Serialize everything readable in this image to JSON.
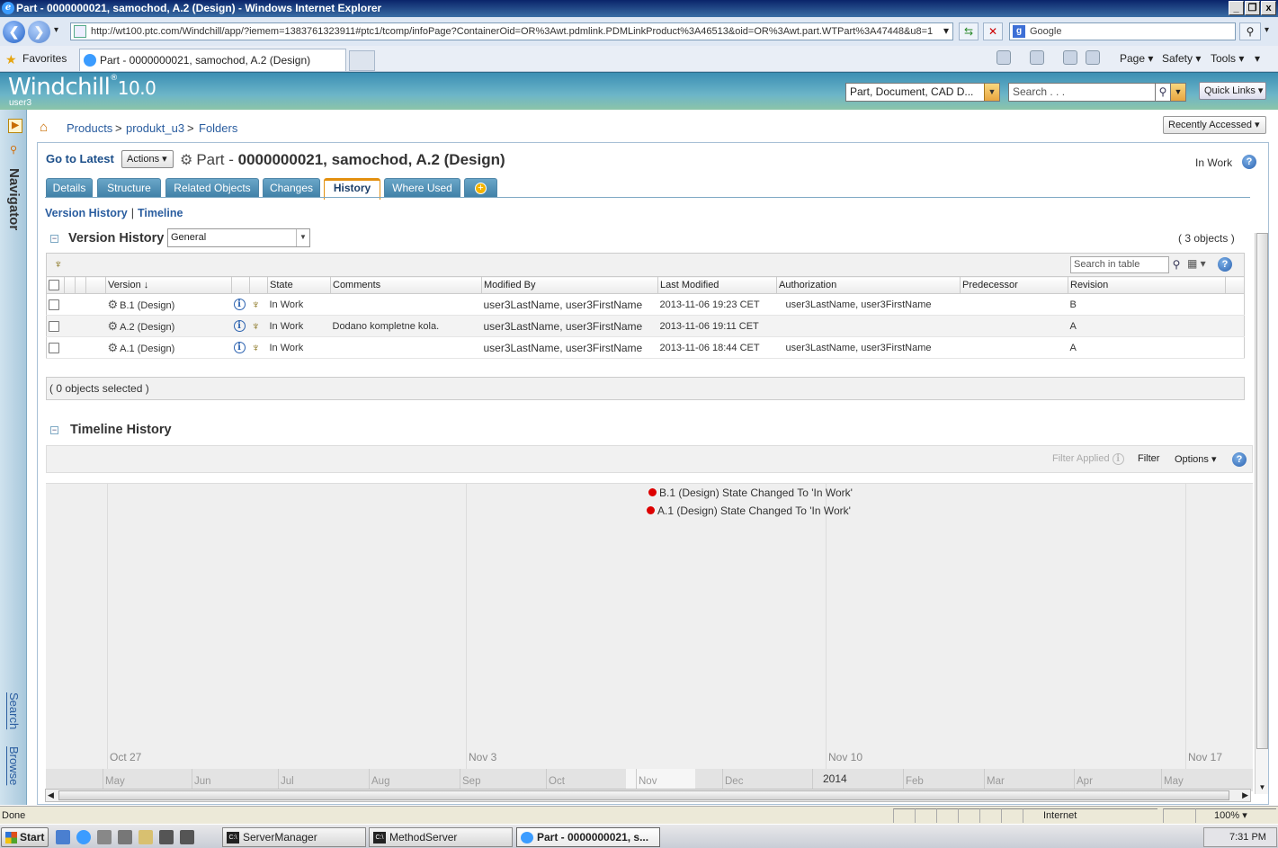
{
  "window": {
    "title": "Part - 0000000021, samochod, A.2 (Design) - Windows Internet Explorer",
    "ie_glyph": "e",
    "min_glyph": "_",
    "max_glyph": "❐",
    "close_glyph": "x"
  },
  "browser": {
    "back_glyph": "❮",
    "forward_glyph": "❯",
    "dropdown_glyph": "▾",
    "address": "http://wt100.ptc.com/Windchill/app/?iemem=1383761323911#ptc1/tcomp/infoPage?ContainerOid=OR%3Awt.pdmlink.PDMLinkProduct%3A46513&oid=OR%3Awt.part.WTPart%3A47448&u8=1",
    "refresh_glyph": "⇆",
    "stop_glyph": "✕",
    "search_provider": "Google",
    "search_provider_glyph": "g",
    "search_go_glyph": "⚲",
    "favorites_star_glyph": "★",
    "favorites_label": "Favorites",
    "tab_title": "Part - 0000000021, samochod, A.2 (Design)",
    "menu": {
      "page": "Page ▾",
      "safety": "Safety ▾",
      "tools": "Tools ▾",
      "more": "▾"
    }
  },
  "app": {
    "logo_text": "Windchill",
    "logo_reg": "®",
    "logo_version": "10.0",
    "user": "user3",
    "type_select": "Part, Document, CAD D...",
    "type_select_arrow": "▼",
    "search_placeholder": "Search . . .",
    "search_go_glyph": "⚲",
    "search_dd_glyph": "▼",
    "quick_links": "Quick Links ▾",
    "recently_accessed": "Recently Accessed ▾"
  },
  "navigator": {
    "toggle_glyph": "▶",
    "pin_glyph": "⚲",
    "label": "Navigator",
    "search_link": "Search",
    "browse_link": "Browse"
  },
  "breadcrumb": {
    "home_glyph": "⌂",
    "items": [
      "Products",
      "produkt_u3",
      "Folders"
    ],
    "separator": ">"
  },
  "page": {
    "go_to_latest": "Go to Latest",
    "actions": "Actions ▾",
    "gear_glyph": "⚙",
    "title_prefix": "Part - ",
    "title_main": "0000000021, samochod, A.2 (Design)",
    "state": "In Work",
    "help_glyph": "?",
    "tabs": [
      "Details",
      "Structure",
      "Related Objects",
      "Changes",
      "History",
      "Where Used"
    ],
    "tab_add_glyph": "+",
    "active_tab": "History",
    "sublinks": [
      "Version History",
      "Timeline"
    ],
    "sublink_sep": "|"
  },
  "version_history": {
    "collapse_glyph": "−",
    "title": "Version History",
    "view": "General",
    "view_arrow": "▼",
    "count_label": "( 3 objects )",
    "tree_glyph": "♆",
    "search_placeholder": "Search in table",
    "search_go_glyph": "⚲",
    "columns_glyph": "▦ ▾",
    "sort_glyph": "↓",
    "columns": [
      "Version",
      "State",
      "Comments",
      "Modified By",
      "Last Modified",
      "Authorization",
      "Predecessor",
      "Revision"
    ],
    "info_glyph": "i",
    "rows": [
      {
        "version": "B.1 (Design)",
        "state": "In Work",
        "comments": "",
        "modified_by": "user3LastName, user3FirstName",
        "last_modified": "2013-11-06 19:23 CET",
        "authorization": "user3LastName, user3FirstName",
        "predecessor": "",
        "revision": "B"
      },
      {
        "version": "A.2 (Design)",
        "state": "In Work",
        "comments": "Dodano kompletne kola.",
        "modified_by": "user3LastName, user3FirstName",
        "last_modified": "2013-11-06 19:11 CET",
        "authorization": "",
        "predecessor": "",
        "revision": "A"
      },
      {
        "version": "A.1 (Design)",
        "state": "In Work",
        "comments": "",
        "modified_by": "user3LastName, user3FirstName",
        "last_modified": "2013-11-06 18:44 CET",
        "authorization": "user3LastName, user3FirstName",
        "predecessor": "",
        "revision": "A"
      }
    ],
    "selected_label": "( 0 objects selected )"
  },
  "timeline": {
    "collapse_glyph": "−",
    "title": "Timeline History",
    "filter_applied": "Filter Applied",
    "filter": "Filter",
    "options": "Options ▾",
    "week_labels": [
      "Oct 27",
      "Nov 3",
      "Nov 10",
      "Nov 17"
    ],
    "events": [
      "B.1 (Design) State Changed To 'In Work'",
      "A.1 (Design) State Changed To 'In Work'"
    ],
    "month_labels": [
      "May",
      "Jun",
      "Jul",
      "Aug",
      "Sep",
      "Oct",
      "Nov",
      "Dec",
      "Feb",
      "Mar",
      "Apr",
      "May"
    ],
    "year_label": "2014",
    "scroll_left": "◀",
    "scroll_right": "▶",
    "scroll_down": "▼"
  },
  "statusbar": {
    "status": "Done",
    "zone": "Internet",
    "zoom": "100%",
    "zoom_arrow": "▾"
  },
  "taskbar": {
    "start": "Start",
    "buttons": [
      "ServerManager",
      "MethodServer",
      "Part - 0000000021, s..."
    ],
    "console_glyph": "C:\\",
    "clock": "7:31 PM"
  }
}
